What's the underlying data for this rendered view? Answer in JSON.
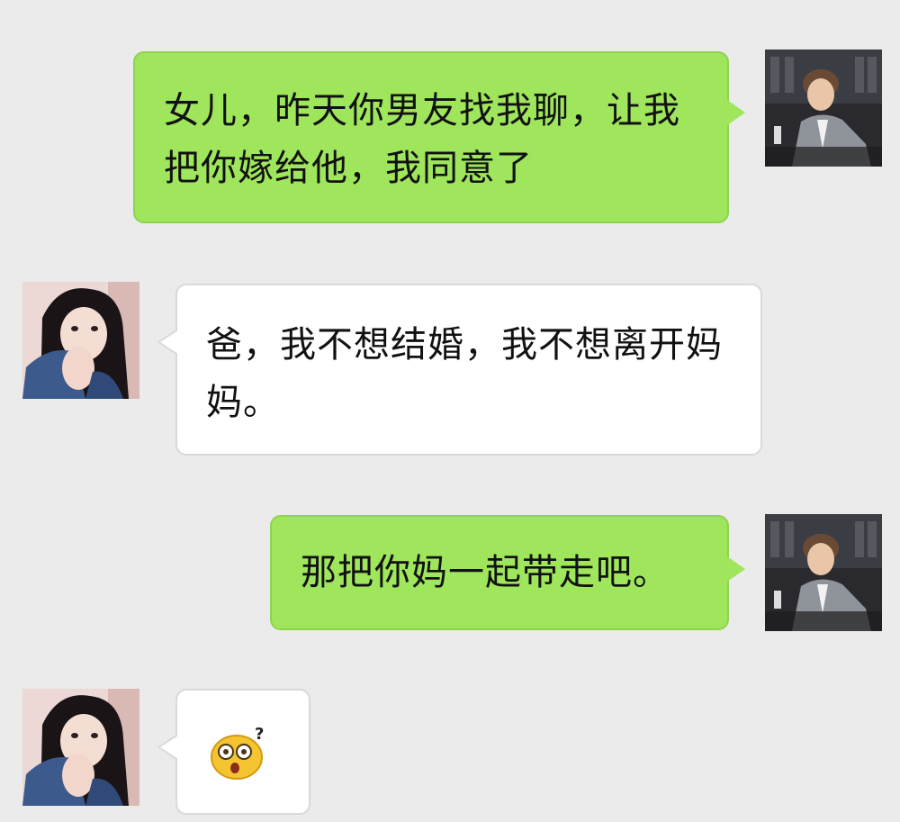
{
  "conversation": {
    "messages": [
      {
        "sender": "father",
        "direction": "outgoing",
        "text": "女儿，昨天你男友找我聊，让我把你嫁给他，我同意了"
      },
      {
        "sender": "daughter",
        "direction": "incoming",
        "text": "爸，我不想结婚，我不想离开妈妈。"
      },
      {
        "sender": "father",
        "direction": "outgoing",
        "text": "那把你妈一起带走吧。"
      },
      {
        "sender": "daughter",
        "direction": "incoming",
        "emoji": "shocked-question-face"
      }
    ]
  },
  "colors": {
    "background": "#ebebeb",
    "outgoing_bubble": "#9fe65c",
    "incoming_bubble": "#ffffff"
  }
}
